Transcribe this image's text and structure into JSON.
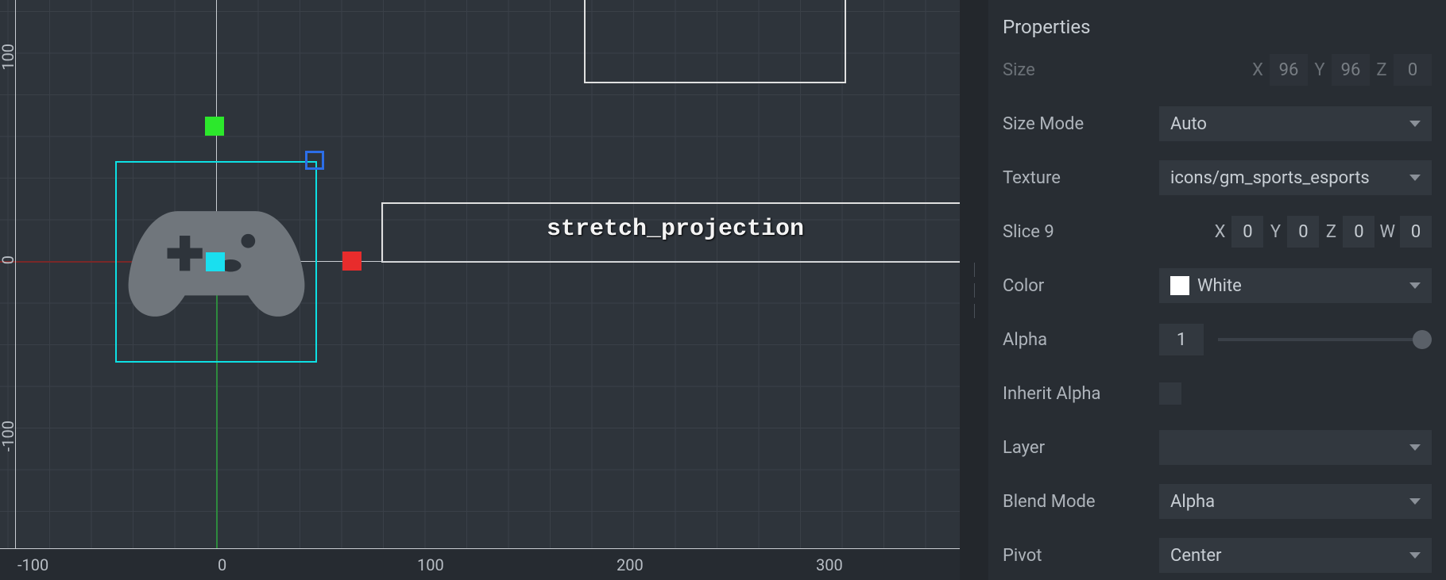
{
  "viewport": {
    "ruler_bottom": [
      "-100",
      "0",
      "100",
      "200",
      "300"
    ],
    "ruler_left": [
      "-100",
      "0",
      "100"
    ],
    "node_label": "stretch_projection"
  },
  "properties": {
    "title": "Properties",
    "size": {
      "label": "Size",
      "x_label": "X",
      "x": "96",
      "y_label": "Y",
      "y": "96",
      "z_label": "Z",
      "z": "0"
    },
    "size_mode": {
      "label": "Size Mode",
      "value": "Auto"
    },
    "texture": {
      "label": "Texture",
      "value": "icons/gm_sports_esports"
    },
    "slice9": {
      "label": "Slice 9",
      "x_label": "X",
      "x": "0",
      "y_label": "Y",
      "y": "0",
      "z_label": "Z",
      "z": "0",
      "w_label": "W",
      "w": "0"
    },
    "color": {
      "label": "Color",
      "value": "White"
    },
    "alpha": {
      "label": "Alpha",
      "value": "1"
    },
    "inherit_alpha": {
      "label": "Inherit Alpha"
    },
    "layer": {
      "label": "Layer",
      "value": ""
    },
    "blend": {
      "label": "Blend Mode",
      "value": "Alpha"
    },
    "pivot": {
      "label": "Pivot",
      "value": "Center"
    }
  }
}
